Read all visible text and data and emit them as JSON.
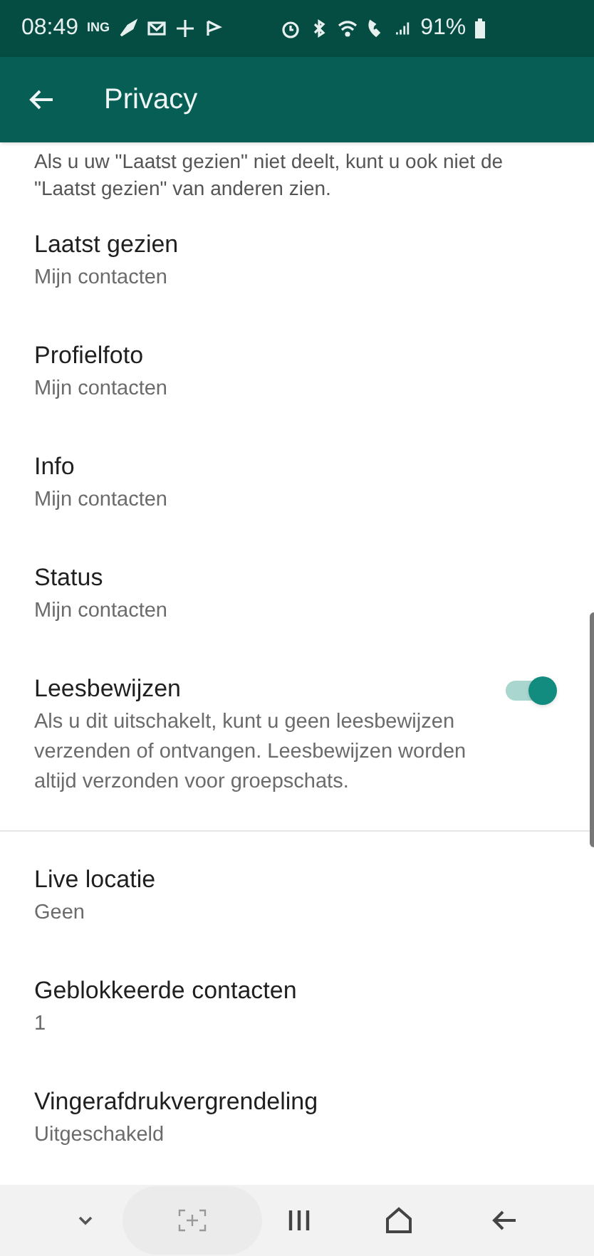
{
  "status_bar": {
    "time": "08:49",
    "carrier": "ING",
    "battery": "91%"
  },
  "app_bar": {
    "title": "Privacy"
  },
  "intro": "Als u uw \"Laatst gezien\" niet deelt, kunt u ook niet de \"Laatst gezien\" van anderen zien.",
  "sections": [
    {
      "items": [
        {
          "kind": "setting",
          "title": "Laatst gezien",
          "subtitle": "Mijn contacten"
        },
        {
          "kind": "setting",
          "title": "Profielfoto",
          "subtitle": "Mijn contacten"
        },
        {
          "kind": "setting",
          "title": "Info",
          "subtitle": "Mijn contacten"
        },
        {
          "kind": "setting",
          "title": "Status",
          "subtitle": "Mijn contacten"
        },
        {
          "kind": "toggle",
          "title": "Leesbewijzen",
          "subtitle": "Als u dit uitschakelt, kunt u geen leesbewijzen verzenden of ontvangen. Leesbewijzen worden altijd verzonden voor groepschats.",
          "on": true
        }
      ]
    },
    {
      "items": [
        {
          "kind": "setting",
          "title": "Live locatie",
          "subtitle": "Geen"
        },
        {
          "kind": "setting",
          "title": "Geblokkeerde contacten",
          "subtitle": "1"
        },
        {
          "kind": "setting",
          "title": "Vingerafdrukvergrendeling",
          "subtitle": "Uitgeschakeld"
        }
      ]
    }
  ]
}
